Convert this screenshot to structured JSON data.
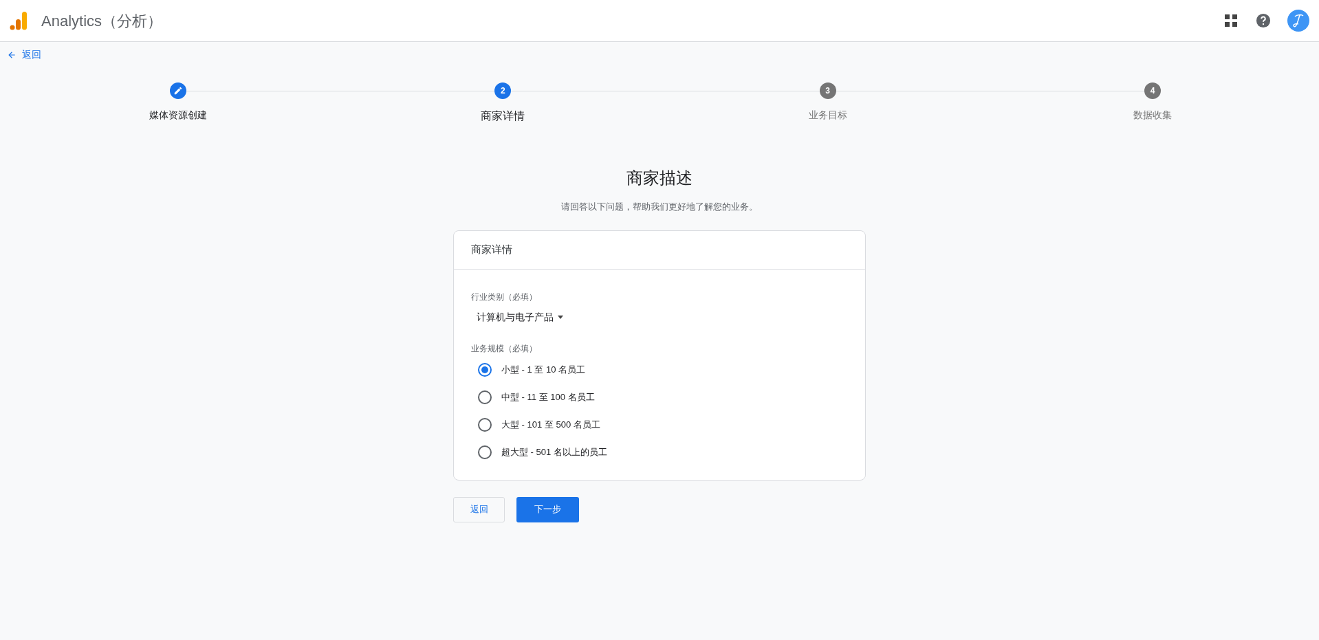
{
  "header": {
    "app_title": "Analytics（分析）"
  },
  "back_link": "返回",
  "steps": [
    {
      "label": "媒体资源创建",
      "completed": true,
      "selected": false
    },
    {
      "number": "2",
      "label": "商家详情",
      "completed": false,
      "selected": true
    },
    {
      "number": "3",
      "label": "业务目标",
      "completed": false,
      "selected": false
    },
    {
      "number": "4",
      "label": "数据收集",
      "completed": false,
      "selected": false
    }
  ],
  "page_title": "商家描述",
  "page_subtitle": "请回答以下问题，帮助我们更好地了解您的业务。",
  "card": {
    "title": "商家详情",
    "industry": {
      "label": "行业类别（必填）",
      "value": "计算机与电子产品"
    },
    "size": {
      "label": "业务规模（必填）",
      "options": [
        {
          "label": "小型 - 1 至 10 名员工",
          "selected": true
        },
        {
          "label": "中型 - 11 至 100 名员工",
          "selected": false
        },
        {
          "label": "大型 - 101 至 500 名员工",
          "selected": false
        },
        {
          "label": "超大型 - 501 名以上的员工",
          "selected": false
        }
      ]
    }
  },
  "buttons": {
    "back": "返回",
    "next": "下一步"
  }
}
